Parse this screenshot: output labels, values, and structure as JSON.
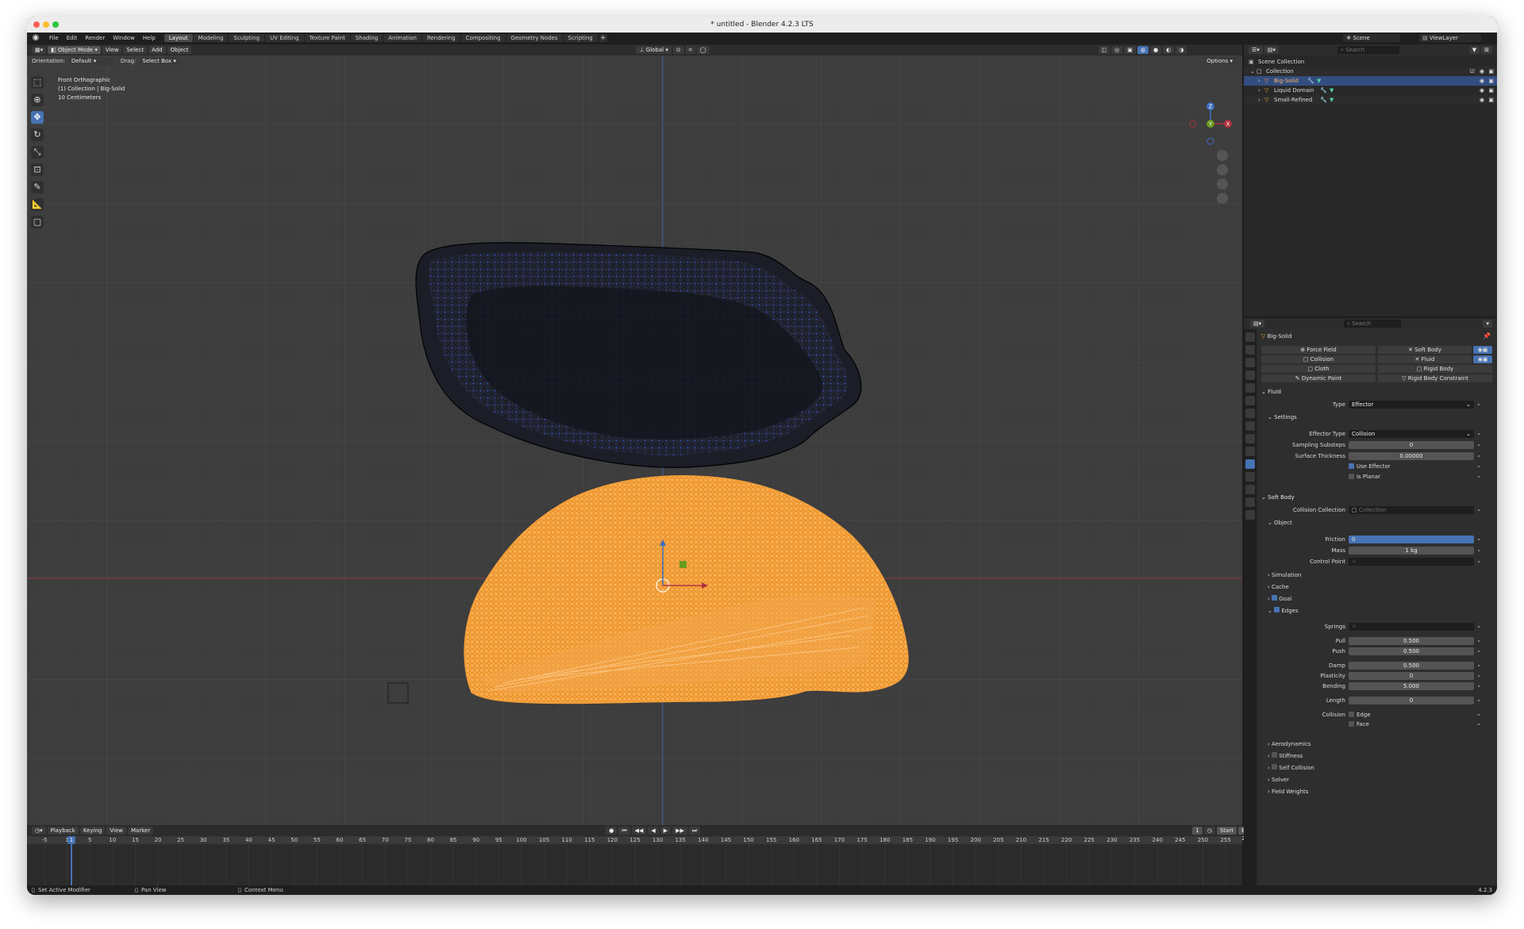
{
  "window": {
    "title": "* untitled - Blender 4.2.3 LTS"
  },
  "topbar": {
    "menus": [
      "File",
      "Edit",
      "Render",
      "Window",
      "Help"
    ],
    "workspaces": [
      "Layout",
      "Modeling",
      "Sculpting",
      "UV Editing",
      "Texture Paint",
      "Shading",
      "Animation",
      "Rendering",
      "Compositing",
      "Geometry Nodes",
      "Scripting"
    ],
    "active_workspace": "Layout",
    "scene": "Scene",
    "view_layer": "ViewLayer"
  },
  "viewport": {
    "mode": "Object Mode",
    "menus": [
      "View",
      "Select",
      "Add",
      "Object"
    ],
    "transform_orientation": "Global",
    "options_label": "Options",
    "orientation_label": "Orientation:",
    "orientation_value": "Default",
    "drag_label": "Drag:",
    "drag_value": "Select Box",
    "info": {
      "view_name": "Front Orthographic",
      "collection_line": "(1) Collection | Big-Solid",
      "scale": "10 Centimeters"
    },
    "tools": [
      "select-box-icon",
      "cursor-icon",
      "move-icon",
      "rotate-icon",
      "scale-icon",
      "transform-icon",
      "annotate-icon",
      "measure-icon",
      "add-cube-icon"
    ],
    "gizmo_axes": [
      "X",
      "Y",
      "Z"
    ]
  },
  "timeline": {
    "menus": [
      "Playback",
      "Keying",
      "View",
      "Marker"
    ],
    "current_frame": "1",
    "start_label": "Start",
    "start": "1",
    "end_label": "End",
    "end": "250",
    "ticks": [
      "-5",
      "1",
      "5",
      "10",
      "15",
      "20",
      "25",
      "30",
      "35",
      "40",
      "45",
      "50",
      "55",
      "60",
      "65",
      "70",
      "75",
      "80",
      "85",
      "90",
      "95",
      "100",
      "105",
      "110",
      "115",
      "120",
      "125",
      "130",
      "135",
      "140",
      "145",
      "150",
      "155",
      "160",
      "165",
      "170",
      "175",
      "180",
      "185",
      "190",
      "195",
      "200",
      "205",
      "210",
      "215",
      "220",
      "225",
      "230",
      "235",
      "240",
      "245",
      "250",
      "255"
    ]
  },
  "status_bar": {
    "hints": [
      "Set Active Modifier",
      "Pan View",
      "Context Menu"
    ],
    "version": "4.2.3"
  },
  "outliner": {
    "search_placeholder": "Search",
    "rows": [
      {
        "label": "Scene Collection"
      },
      {
        "label": "Collection"
      },
      {
        "label": "Big-Solid"
      },
      {
        "label": "Liquid Domain"
      },
      {
        "label": "Small-Refined"
      }
    ]
  },
  "properties": {
    "search_placeholder": "Search",
    "object_name": "Big-Solid",
    "physics_buttons": {
      "force_field": "Force Field",
      "collision": "Collision",
      "cloth": "Cloth",
      "dynamic_paint": "Dynamic Paint",
      "soft_body": "Soft Body",
      "fluid": "Fluid",
      "rigid_body": "Rigid Body",
      "rigid_body_constraint": "Rigid Body Constraint"
    },
    "fluid": {
      "title": "Fluid",
      "type_label": "Type",
      "type": "Effector",
      "settings_title": "Settings",
      "effector_type_label": "Effector Type",
      "effector_type": "Collision",
      "sampling_label": "Sampling Substeps",
      "sampling": "0",
      "thickness_label": "Surface Thickness",
      "thickness": "0.00000",
      "use_effector_label": "Use Effector",
      "is_planar_label": "Is Planar"
    },
    "soft_body": {
      "title": "Soft Body",
      "collision_collection_label": "Collision Collection",
      "collision_collection_placeholder": "Collection",
      "object_title": "Object",
      "friction_label": "Friction",
      "friction": "0",
      "mass_label": "Mass",
      "mass": "1 kg",
      "control_point_label": "Control Point",
      "simulation_title": "Simulation",
      "cache_title": "Cache",
      "goal_title": "Goal",
      "edges_title": "Edges",
      "springs_label": "Springs",
      "pull_label": "Pull",
      "pull": "0.500",
      "push_label": "Push",
      "push": "0.500",
      "damp_label": "Damp",
      "damp": "0.500",
      "plasticity_label": "Plasticity",
      "plasticity": "0",
      "bending_label": "Bending",
      "bending": "5.000",
      "length_label": "Length",
      "length": "0",
      "collision_label": "Collision",
      "edge_label": "Edge",
      "face_label": "Face",
      "aerodynamics_title": "Aerodynamics",
      "stiffness_title": "Stiffness",
      "self_collision_title": "Self Collision",
      "solver_title": "Solver",
      "field_weights_title": "Field Weights"
    }
  },
  "colors": {
    "accent": "#4772b3",
    "selected_object": "#f5a03a",
    "x_axis": "#b0323f",
    "y_axis": "#6b9b21",
    "z_axis": "#3d6ebf"
  }
}
